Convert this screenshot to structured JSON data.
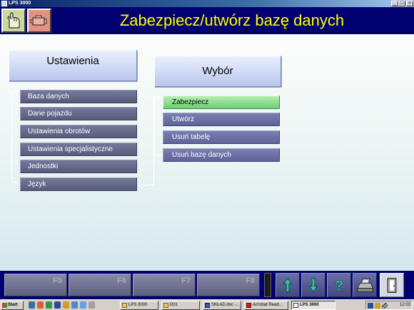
{
  "window": {
    "title": "LPS 3000",
    "minimize": "_",
    "maximize": "□",
    "close": "×"
  },
  "header": {
    "title": "Zabezpiecz/utwórz bazę danych",
    "buttons": [
      {
        "icon": "hand-pointer-icon"
      },
      {
        "icon": "engine-icon"
      }
    ]
  },
  "menu1": {
    "heading": "Ustawienia",
    "items": [
      "Baza danych",
      "Dane pojazdu",
      "Ustawienia obrotów",
      "Ustawienia specjalistyczne",
      "Jednostki",
      "Język"
    ]
  },
  "menu2": {
    "heading": "Wybór",
    "items": [
      {
        "label": "Zabezpiecz",
        "selected": true
      },
      {
        "label": "Utwórz",
        "selected": false
      },
      {
        "label": "Usuń tabelę",
        "selected": false
      },
      {
        "label": "Usuń bazę danych",
        "selected": false
      }
    ]
  },
  "fbar": {
    "fkeys": [
      "F5",
      "F6",
      "F7",
      "F8"
    ],
    "nav": [
      "arrow-up-icon",
      "arrow-down-icon",
      "help-icon",
      "printer-icon",
      "exit-door-icon"
    ]
  },
  "taskbar": {
    "start": "Start",
    "tasks": [
      {
        "label": "LPS 3000",
        "active": false
      },
      {
        "label": "D01",
        "active": false
      },
      {
        "label": "SKŁAD.doc -...",
        "active": false
      },
      {
        "label": "Acrobat Read...",
        "active": false
      },
      {
        "label": "LPS 3000",
        "active": true
      }
    ],
    "clock": "12:03"
  },
  "colors": {
    "header_bg": "#000070",
    "title_text": "#ffff00",
    "selected_item": "#6ccf72",
    "menu_item": "#5f649a"
  }
}
